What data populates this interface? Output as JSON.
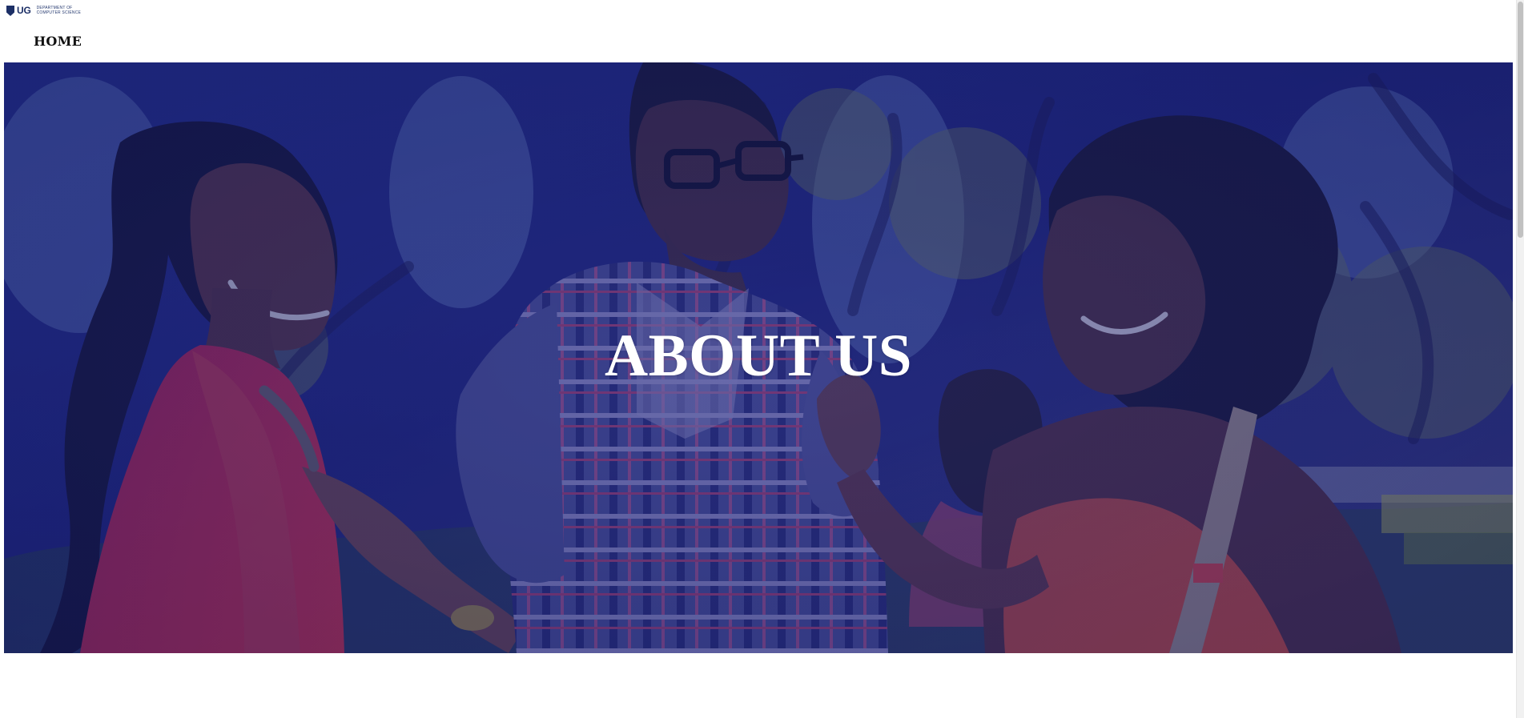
{
  "header": {
    "logo": {
      "mark": "UG",
      "department_lines": [
        "DEPARTMENT OF",
        "COMPUTER SCIENCE"
      ]
    },
    "nav": {
      "items": [
        {
          "label": "HOME"
        }
      ]
    }
  },
  "hero": {
    "title": "ABOUT US",
    "overlay_color": "#1F2B8F",
    "image": "people-laughing-outdoors"
  },
  "colors": {
    "logo_blue": "#1C2F66",
    "nav_text": "#111111",
    "page_background": "#FFFFFF",
    "hero_title": "#FFFFFF"
  }
}
